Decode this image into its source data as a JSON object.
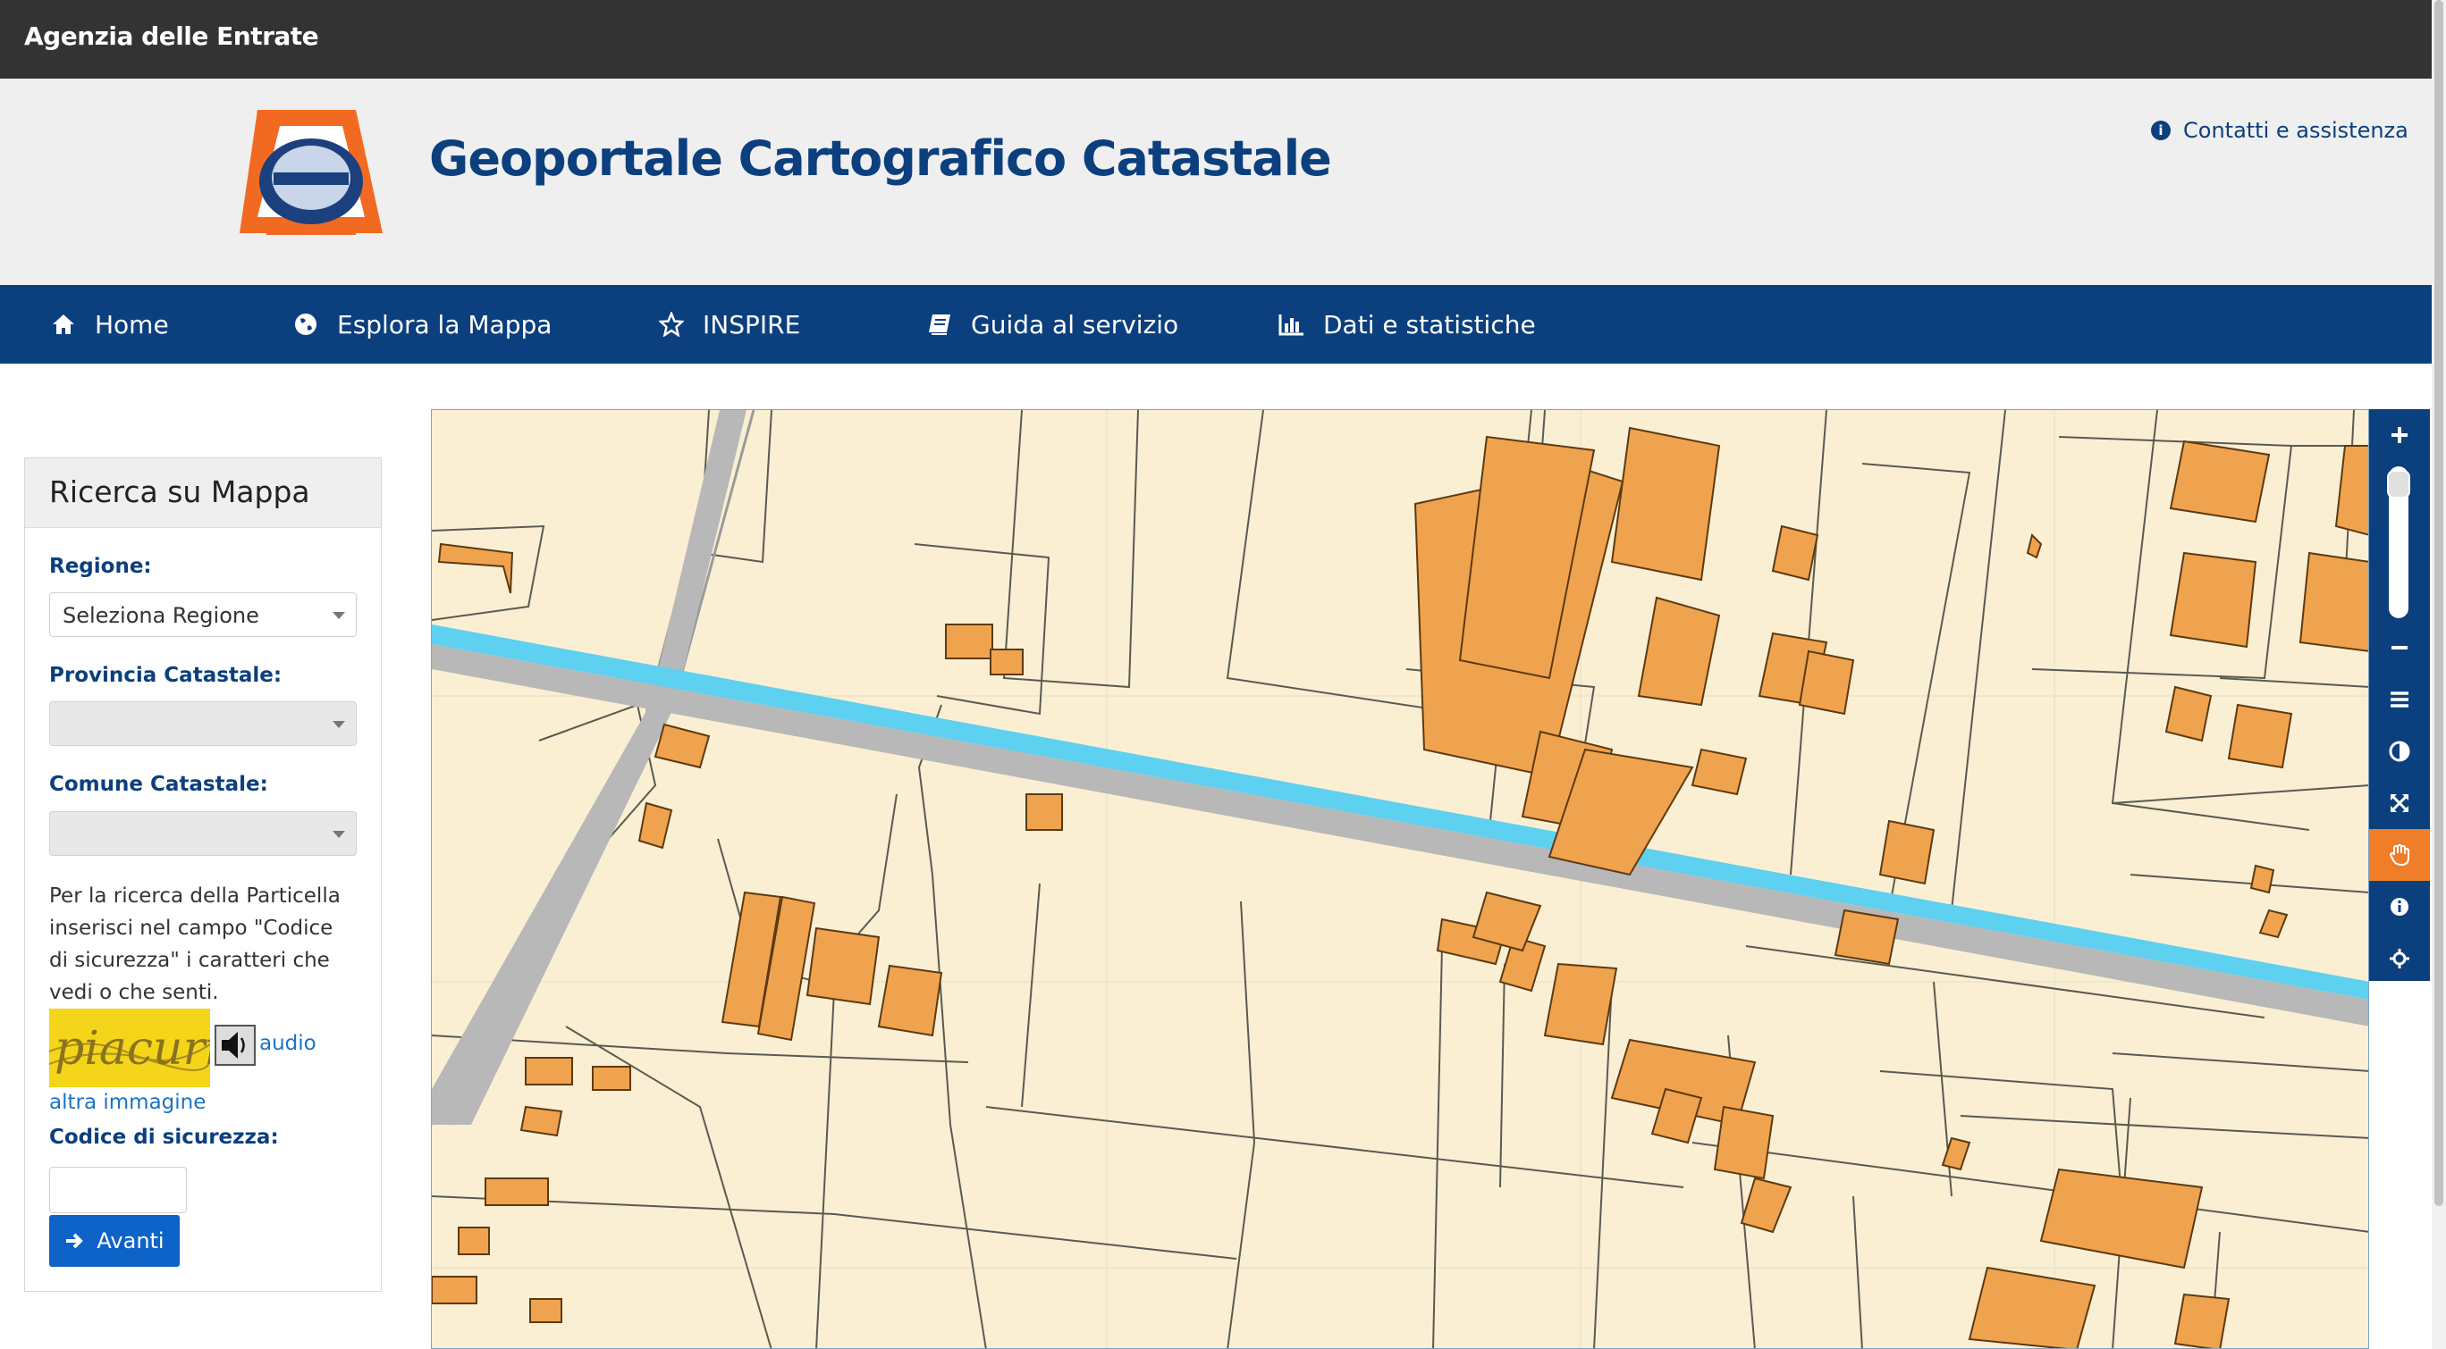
{
  "topbar": {
    "brand": "Agenzia delle Entrate"
  },
  "header": {
    "title": "Geoportale Cartografico Catastale",
    "contacts_label": "Contatti e assistenza"
  },
  "nav": [
    {
      "label": "Home",
      "icon": "home-icon"
    },
    {
      "label": "Esplora la Mappa",
      "icon": "globe-icon"
    },
    {
      "label": "INSPIRE",
      "icon": "star-icon"
    },
    {
      "label": "Guida al servizio",
      "icon": "book-icon"
    },
    {
      "label": "Dati e statistiche",
      "icon": "bar-chart-icon"
    }
  ],
  "search": {
    "title": "Ricerca su Mappa",
    "region_label": "Regione:",
    "region_value": "Seleziona Regione",
    "province_label": "Provincia Catastale:",
    "province_value": "",
    "comune_label": "Comune Catastale:",
    "comune_value": "",
    "info_text": "Per la ricerca della Particella inserisci nel campo \"Codice di sicurezza\" i caratteri che vedi o che senti.",
    "captcha_text": "piacuri",
    "audio_label": "audio",
    "alt_image_label": "altra immagine",
    "code_label": "Codice di sicurezza:",
    "code_value": "",
    "submit_label": "Avanti"
  },
  "map_tools": [
    "zoom-in-icon",
    "zoom-slider",
    "zoom-out-icon",
    "layers-icon",
    "contrast-icon",
    "fullscreen-icon",
    "pan-hand-icon",
    "info-icon",
    "locate-icon"
  ],
  "colors": {
    "topbar": "#333333",
    "header_bg": "#efefef",
    "brand_blue": "#0b3f7e",
    "button_blue": "#0d63c7",
    "accent_orange": "#f07d28",
    "parcel_fill": "#fbefd3",
    "building_fill": "#f0a34e",
    "river": "#5ed0f0",
    "road": "#b8b8b8"
  }
}
